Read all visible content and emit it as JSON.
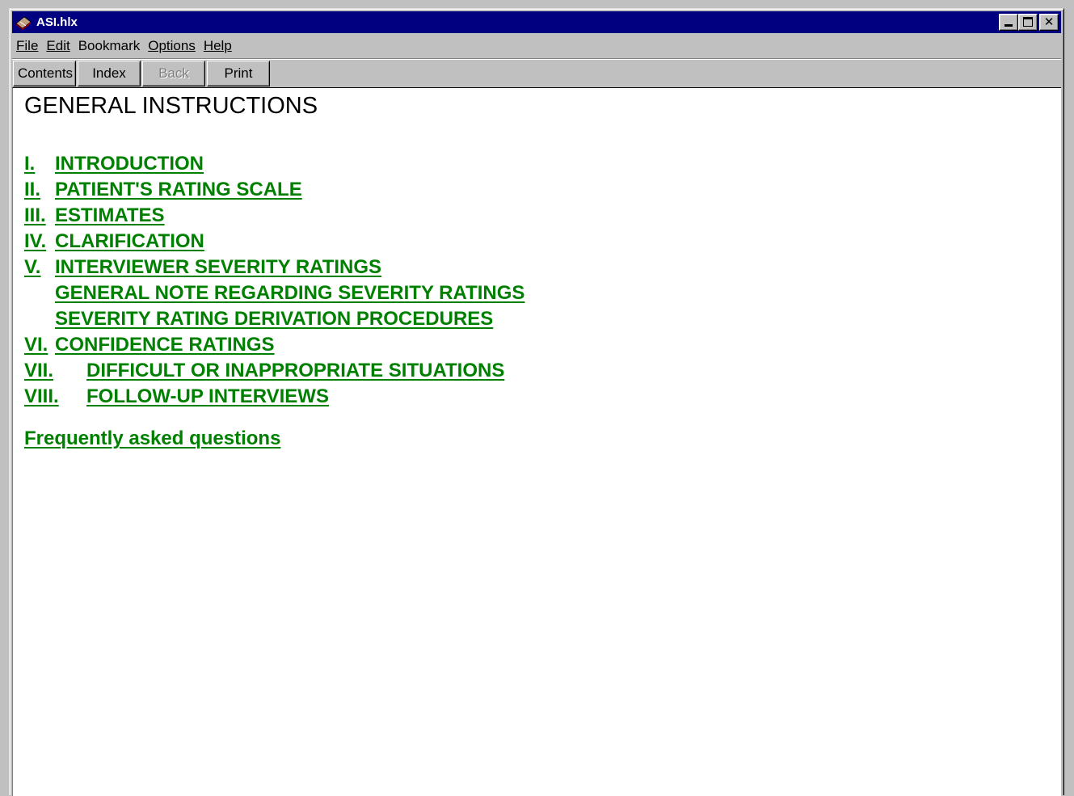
{
  "window": {
    "title": "ASI.hlx",
    "icon": "help-book-icon",
    "accent_color": "#000080"
  },
  "menu": {
    "file": "File",
    "edit": "Edit",
    "bookmark": "Bookmark",
    "options": "Options",
    "help": "Help"
  },
  "buttons": {
    "contents": "Contents",
    "index": "Index",
    "back": "Back",
    "print": "Print"
  },
  "content": {
    "title": "GENERAL INSTRUCTIONS",
    "link_color": "#008000",
    "toc": [
      {
        "num": "I.",
        "label": "INTRODUCTION"
      },
      {
        "num": "II.",
        "label": "PATIENT'S RATING SCALE"
      },
      {
        "num": "III.",
        "label": "ESTIMATES"
      },
      {
        "num": "IV.",
        "label": "CLARIFICATION"
      },
      {
        "num": "V.",
        "label": "INTERVIEWER SEVERITY RATINGS"
      },
      {
        "num": "",
        "label": "GENERAL NOTE REGARDING SEVERITY RATINGS"
      },
      {
        "num": "",
        "label": "SEVERITY RATING DERIVATION PROCEDURES"
      },
      {
        "num": "VI.",
        "label": "CONFIDENCE RATINGS"
      },
      {
        "num": "VII.",
        "label": "DIFFICULT OR INAPPROPRIATE SITUATIONS"
      },
      {
        "num": "VIII.",
        "label": "FOLLOW-UP INTERVIEWS"
      }
    ],
    "faq": "Frequently asked questions"
  }
}
